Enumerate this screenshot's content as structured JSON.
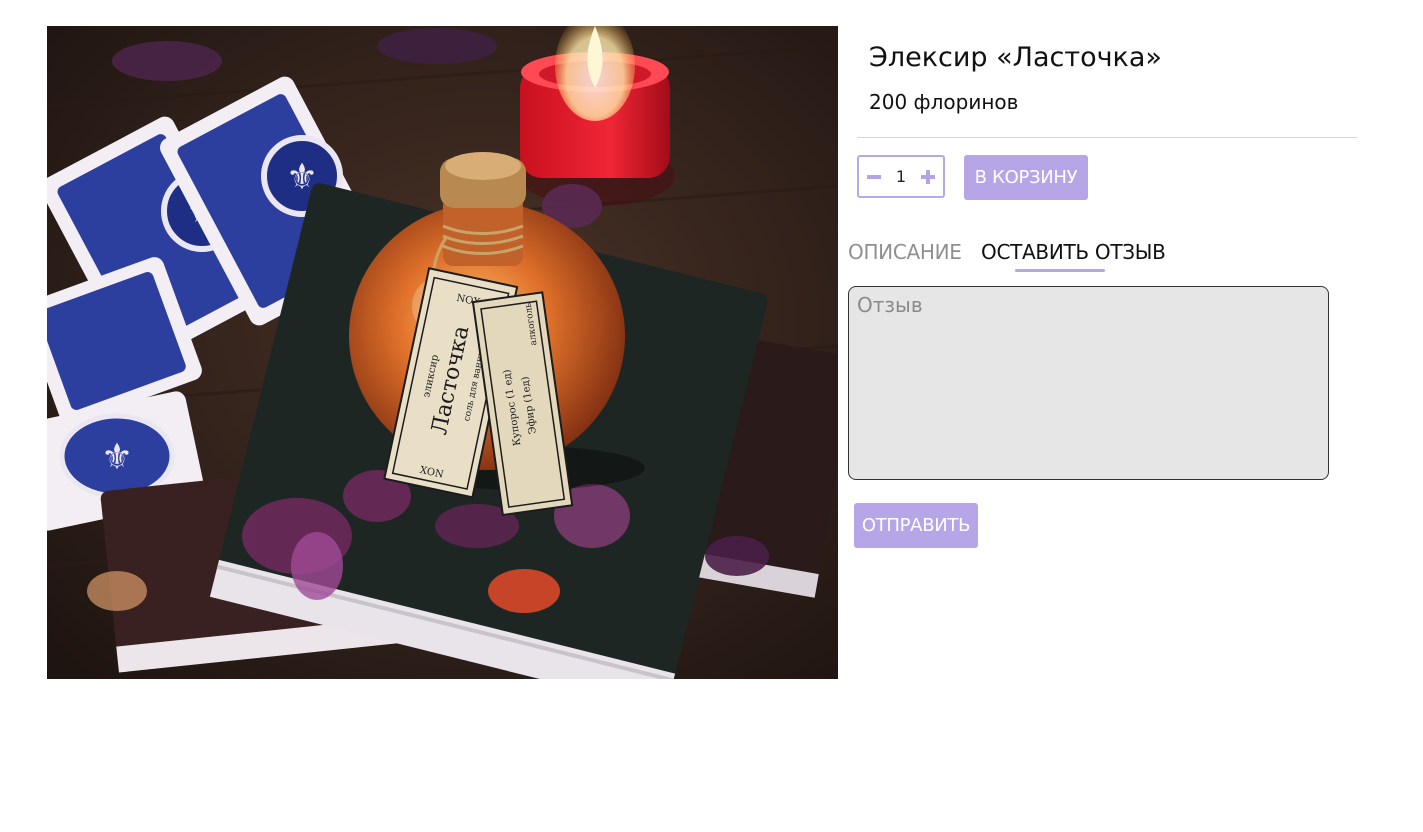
{
  "product": {
    "title": "Элексир «Ласточка»",
    "price": "200 флоринов"
  },
  "cart": {
    "quantity": "1",
    "add_to_cart_label": "В КОРЗИНУ"
  },
  "tabs": [
    {
      "label": "ОПИСАНИЕ",
      "active": false
    },
    {
      "label": "ОСТАВИТЬ ОТЗЫВ",
      "active": true
    }
  ],
  "review": {
    "placeholder": "Отзыв",
    "value": "",
    "submit_label": "ОТПРАВИТЬ"
  },
  "image": {
    "bottle_label_main": "Ласточка",
    "bottle_label_top": "эликсир",
    "bottle_label_sub": "соль для ванны",
    "bottle_label_brand_top": "NOX",
    "bottle_label_brand_bottom": "XON",
    "tag_label_1": "Купорос (1 ед)",
    "tag_label_2": "Эфир (1ед)",
    "tag_label_3": "алкоголь"
  },
  "colors": {
    "accent": "#b6a6e8",
    "tab_inactive": "#8f8f8f",
    "textarea_bg": "#e6e6e6"
  },
  "icons": {
    "minus": "minus-icon",
    "plus": "plus-icon"
  }
}
